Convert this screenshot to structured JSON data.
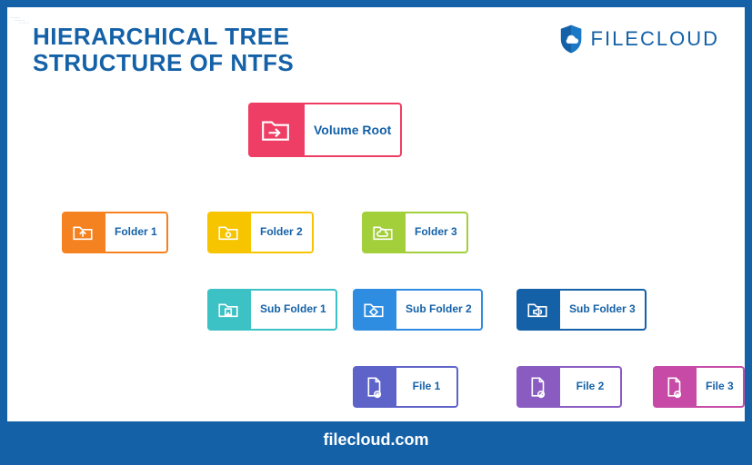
{
  "header": {
    "title": "HIERARCHICAL TREE STRUCTURE OF NTFS",
    "brand": "FILECLOUD"
  },
  "colors": {
    "primary": "#1461a8",
    "root": "#ef3e65",
    "folder1": "#f58220",
    "folder2": "#f6c500",
    "folder3": "#a3cf3b",
    "sub1": "#3cc1c4",
    "sub2": "#2e8de0",
    "sub3": "#1461a8",
    "file1": "#5d63c9",
    "file2": "#8a5bc1",
    "file3": "#c64aa6"
  },
  "nodes": {
    "root": {
      "label": "Volume Root"
    },
    "folder1": {
      "label": "Folder 1"
    },
    "folder2": {
      "label": "Folder 2"
    },
    "folder3": {
      "label": "Folder 3"
    },
    "sub1": {
      "label": "Sub Folder 1"
    },
    "sub2": {
      "label": "Sub Folder 2"
    },
    "sub3": {
      "label": "Sub Folder 3"
    },
    "file1": {
      "label": "File 1"
    },
    "file2": {
      "label": "File 2"
    },
    "file3": {
      "label": "File 3"
    }
  },
  "footer": "filecloud.com"
}
